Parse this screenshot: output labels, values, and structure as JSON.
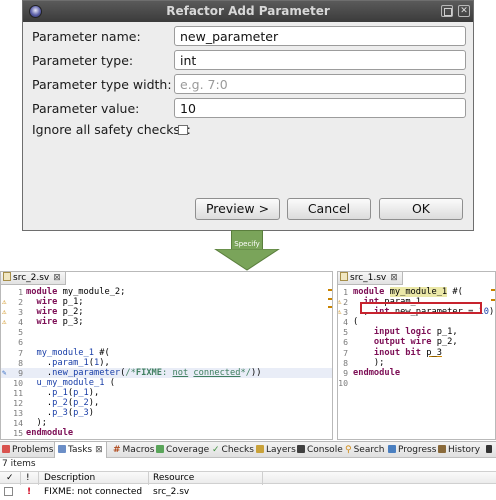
{
  "dialog": {
    "title": "Refactor Add Parameter",
    "fields": [
      {
        "label": "Parameter name:",
        "value": "new_parameter",
        "placeholder": ""
      },
      {
        "label": "Parameter type:",
        "value": "int",
        "placeholder": ""
      },
      {
        "label": "Parameter type width:",
        "value": "",
        "placeholder": "e.g. 7:0"
      },
      {
        "label": "Parameter value:",
        "value": "10",
        "placeholder": ""
      }
    ],
    "checkbox_label": "Ignore all safety checks?:",
    "checkbox_checked": false,
    "buttons": {
      "preview": "Preview >",
      "cancel": "Cancel",
      "ok": "OK"
    }
  },
  "arrow": {
    "label": "Specify",
    "color": "#7aa45a"
  },
  "left_editor": {
    "tab": "src_2.sv",
    "lines": [
      {
        "n": "1",
        "t": "module my_module_2;"
      },
      {
        "n": "2",
        "t": "  wire p_1;"
      },
      {
        "n": "3",
        "t": "  wire p_2;"
      },
      {
        "n": "4",
        "t": "  wire p_3;"
      },
      {
        "n": "5",
        "t": ""
      },
      {
        "n": "6",
        "t": ""
      },
      {
        "n": "7",
        "t": "  my_module_1 #("
      },
      {
        "n": "8",
        "t": "    .param_1(1),"
      },
      {
        "n": "9",
        "t": "    .new_parameter(/*FIXME: not connected*/))"
      },
      {
        "n": "10",
        "t": "  u_my_module_1 ("
      },
      {
        "n": "11",
        "t": "    .p_1(p_1),"
      },
      {
        "n": "12",
        "t": "    .p_2(p_2),"
      },
      {
        "n": "13",
        "t": "    .p_3(p_3)"
      },
      {
        "n": "14",
        "t": "  );"
      },
      {
        "n": "15",
        "t": "endmodule"
      }
    ]
  },
  "right_editor": {
    "tab": "src_1.sv",
    "lines": [
      {
        "n": "1",
        "t": "module my_module_1 #("
      },
      {
        "n": "2",
        "t": "  int param_1"
      },
      {
        "n": "3",
        "t": "  , int new_parameter = 10)"
      },
      {
        "n": "4",
        "t": "("
      },
      {
        "n": "5",
        "t": "    input logic p_1,"
      },
      {
        "n": "6",
        "t": "    output wire p_2,"
      },
      {
        "n": "7",
        "t": "    inout bit p_3"
      },
      {
        "n": "8",
        "t": "    );"
      },
      {
        "n": "9",
        "t": "endmodule"
      },
      {
        "n": "10",
        "t": ""
      }
    ]
  },
  "panel": {
    "tabs": [
      "Problems",
      "Tasks",
      "Macros",
      "Coverage",
      "Checks",
      "Layers",
      "Console",
      "Search",
      "Progress",
      "History"
    ],
    "items_count": "7 items",
    "columns": [
      "!",
      "Description",
      "Resource"
    ],
    "rows": [
      {
        "priority": "!",
        "description": "FIXME: not connected",
        "resource": "src_2.sv"
      }
    ]
  },
  "colors": {
    "accent_red": "#c7232e",
    "keyword": "#7d0f56",
    "arrow_green": "#7aa45a"
  }
}
